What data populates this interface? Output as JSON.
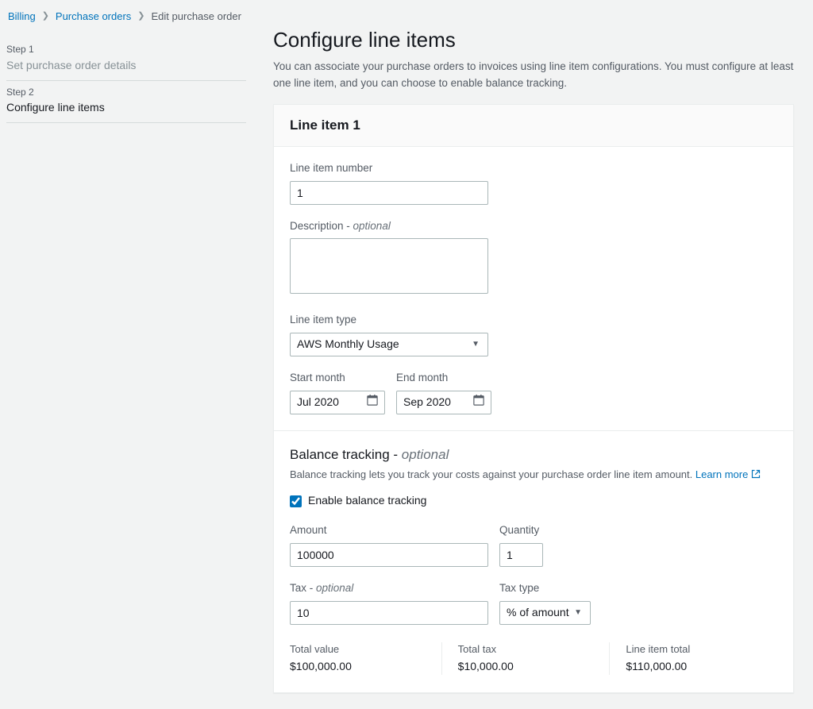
{
  "breadcrumbs": {
    "items": [
      {
        "label": "Billing",
        "link": true
      },
      {
        "label": "Purchase orders",
        "link": true
      },
      {
        "label": "Edit purchase order",
        "link": false
      }
    ]
  },
  "steps": [
    {
      "num": "Step 1",
      "title": "Set purchase order details",
      "active": false
    },
    {
      "num": "Step 2",
      "title": "Configure line items",
      "active": true
    }
  ],
  "page": {
    "title": "Configure line items",
    "description": "You can associate your purchase orders to invoices using line item configurations. You must configure at least one line item, and you can choose to enable balance tracking."
  },
  "card": {
    "title": "Line item 1",
    "lineItemNumber": {
      "label": "Line item number",
      "value": "1"
    },
    "description": {
      "label": "Description - ",
      "optional": "optional",
      "value": ""
    },
    "lineItemType": {
      "label": "Line item type",
      "value": "AWS Monthly Usage"
    },
    "startMonth": {
      "label": "Start month",
      "value": "Jul 2020"
    },
    "endMonth": {
      "label": "End month",
      "value": "Sep 2020"
    },
    "balanceTracking": {
      "title": "Balance tracking - ",
      "optional": "optional",
      "desc": "Balance tracking lets you track your costs against your purchase order line item amount. ",
      "learnMore": "Learn more",
      "checkboxLabel": "Enable balance tracking",
      "checked": true
    },
    "amount": {
      "label": "Amount",
      "value": "100000"
    },
    "quantity": {
      "label": "Quantity",
      "value": "1"
    },
    "tax": {
      "label": "Tax - ",
      "optional": "optional",
      "value": "10"
    },
    "taxType": {
      "label": "Tax type",
      "value": "% of amount"
    },
    "totals": {
      "totalValue": {
        "label": "Total value",
        "value": "$100,000.00"
      },
      "totalTax": {
        "label": "Total tax",
        "value": "$10,000.00"
      },
      "lineItemTotal": {
        "label": "Line item total",
        "value": "$110,000.00"
      }
    }
  }
}
